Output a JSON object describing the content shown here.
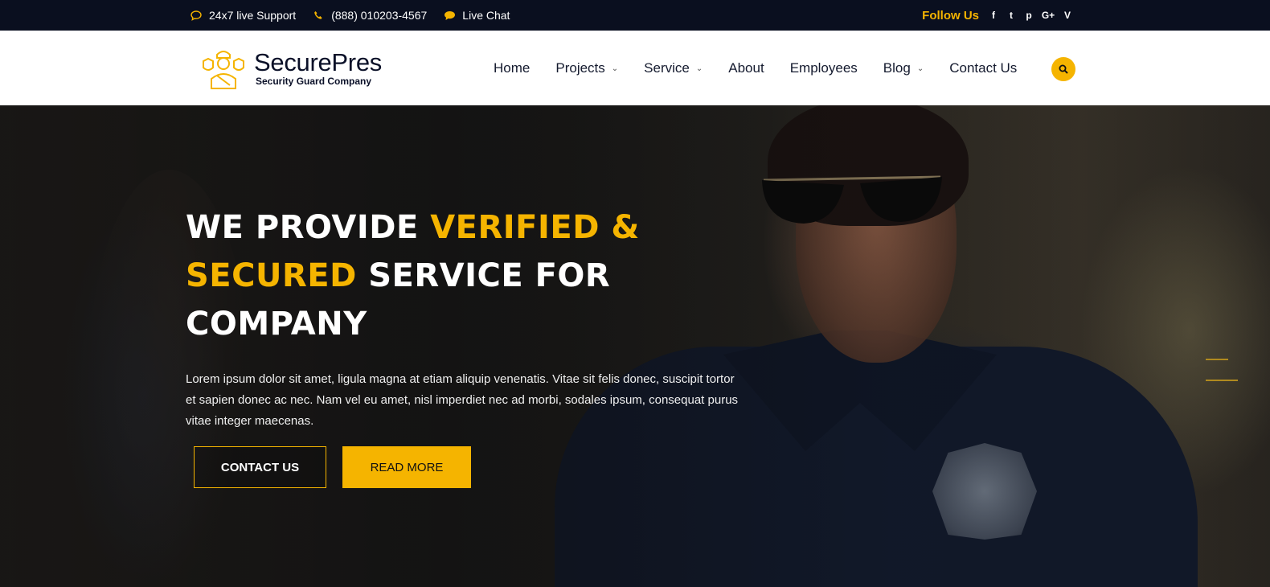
{
  "topbar": {
    "support": "24x7 live Support",
    "phone": "(888) 010203-4567",
    "chat": "Live Chat",
    "follow_label": "Follow Us",
    "social": [
      "f",
      "t",
      "p",
      "G+",
      "V"
    ]
  },
  "header": {
    "brand_name": "SecurePres",
    "brand_sub": "Security Guard Company",
    "nav": [
      {
        "label": "Home"
      },
      {
        "label": "Projects"
      },
      {
        "label": "Service"
      },
      {
        "label": "About"
      },
      {
        "label": "Employees"
      },
      {
        "label": "Blog"
      },
      {
        "label": "Contact Us"
      }
    ]
  },
  "hero": {
    "title_part1": "WE PROVIDE ",
    "title_accent1": "VERIFIED &",
    "title_accent2": "SECURED",
    "title_part2": " SERVICE FOR",
    "title_part3": "COMPANY",
    "text": "Lorem ipsum dolor sit amet, ligula magna at etiam aliquip venenatis. Vitae sit felis donec, suscipit tortor et sapien donec ac nec. Nam vel eu amet, nisl imperdiet nec ad morbi, sodales ipsum, consequat purus vitae integer maecenas.",
    "btn_contact": "CONTACT US",
    "btn_read": "READ MORE"
  },
  "colors": {
    "accent": "#f5b400",
    "topbar_bg": "#0a0f1f",
    "header_bg": "#ffffff"
  },
  "icons": [
    "chat-bubble-icon",
    "phone-icon",
    "chat-icon",
    "facebook-icon",
    "twitter-icon",
    "pinterest-icon",
    "google-plus-icon",
    "vimeo-icon",
    "search-icon",
    "chevron-down-icon",
    "guard-logo-icon"
  ]
}
